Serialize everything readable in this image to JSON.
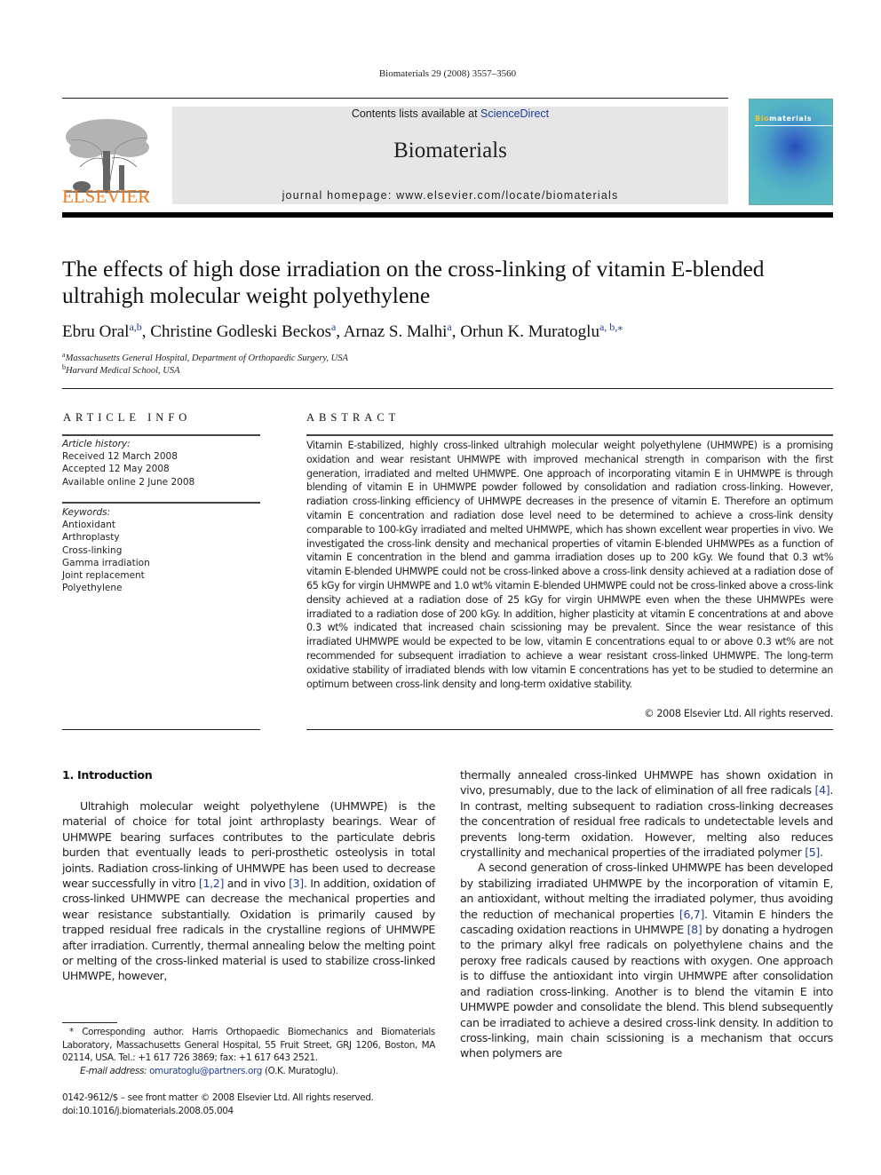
{
  "journal_ref": "Biomaterials 29 (2008) 3557–3560",
  "masthead": {
    "contents_prefix": "Contents lists available at ",
    "contents_link": "ScienceDirect",
    "journal_title": "Biomaterials",
    "homepage": "journal homepage: www.elsevier.com/locate/biomaterials"
  },
  "publisher": {
    "name": "ELSEVIER",
    "logo_icon": "elsevier-tree-icon",
    "brand_color": "#f07a1e"
  },
  "cover": {
    "title_part1": "Bio",
    "title_part2": "materials"
  },
  "article": {
    "title": "The effects of high dose irradiation on the cross-linking of vitamin E-blended ultrahigh molecular weight polyethylene",
    "authors": [
      {
        "name": "Ebru Oral",
        "aff": "a,b"
      },
      {
        "name": "Christine Godleski Beckos",
        "aff": "a"
      },
      {
        "name": "Arnaz S. Malhi",
        "aff": "a"
      },
      {
        "name": "Orhun K. Muratoglu",
        "aff": "a, b,⁎"
      }
    ],
    "affiliations": [
      {
        "mark": "a",
        "text": "Massachusetts General Hospital, Department of Orthopaedic Surgery, USA"
      },
      {
        "mark": "b",
        "text": "Harvard Medical School, USA"
      }
    ]
  },
  "article_info": {
    "heading": "ARTICLE INFO",
    "history_label": "Article history:",
    "history": [
      "Received 12 March 2008",
      "Accepted 12 May 2008",
      "Available online 2 June 2008"
    ],
    "keywords_label": "Keywords:",
    "keywords": [
      "Antioxidant",
      "Arthroplasty",
      "Cross-linking",
      "Gamma irradiation",
      "Joint replacement",
      "Polyethylene"
    ]
  },
  "abstract": {
    "heading": "ABSTRACT",
    "text": "Vitamin E-stabilized, highly cross-linked ultrahigh molecular weight polyethylene (UHMWPE) is a promising oxidation and wear resistant UHMWPE with improved mechanical strength in comparison with the first generation, irradiated and melted UHMWPE. One approach of incorporating vitamin E in UHMWPE is through blending of vitamin E in UHMWPE powder followed by consolidation and radiation cross-linking. However, radiation cross-linking efficiency of UHMWPE decreases in the presence of vitamin E. Therefore an optimum vitamin E concentration and radiation dose level need to be determined to achieve a cross-link density comparable to 100-kGy irradiated and melted UHMWPE, which has shown excellent wear properties in vivo. We investigated the cross-link density and mechanical properties of vitamin E-blended UHMWPEs as a function of vitamin E concentration in the blend and gamma irradiation doses up to 200 kGy. We found that 0.3 wt% vitamin E-blended UHMWPE could not be cross-linked above a cross-link density achieved at a radiation dose of 65 kGy for virgin UHMWPE and 1.0 wt% vitamin E-blended UHMWPE could not be cross-linked above a cross-link density achieved at a radiation dose of 25 kGy for virgin UHMWPE even when the these UHMWPEs were irradiated to a radiation dose of 200 kGy. In addition, higher plasticity at vitamin E concentrations at and above 0.3 wt% indicated that increased chain scissioning may be prevalent. Since the wear resistance of this irradiated UHMWPE would be expected to be low, vitamin E concentrations equal to or above 0.3 wt% are not recommended for subsequent irradiation to achieve a wear resistant cross-linked UHMWPE. The long-term oxidative stability of irradiated blends with low vitamin E concentrations has yet to be studied to determine an optimum between cross-link density and long-term oxidative stability.",
    "copyright": "© 2008 Elsevier Ltd. All rights reserved."
  },
  "introduction": {
    "heading": "1.  Introduction",
    "left_paragraph": [
      {
        "t": "Ultrahigh molecular weight polyethylene (UHMWPE) is the material of choice for total joint arthroplasty bearings. Wear of UHMWPE bearing surfaces contributes to the particulate debris burden that eventually leads to peri-prosthetic osteolysis in total joints. Radiation cross-linking of UHMWPE has been used to decrease wear successfully in vitro "
      },
      {
        "c": "[1,2]"
      },
      {
        "t": " and in vivo "
      },
      {
        "c": "[3]"
      },
      {
        "t": ". In addition, oxidation of cross-linked UHMWPE can decrease the mechanical properties and wear resistance substantially. Oxidation is primarily caused by trapped residual free radicals in the crystalline regions of UHMWPE after irradiation. Currently, thermal annealing below the melting point or melting of the cross-linked material is used to stabilize cross-linked UHMWPE, however,"
      }
    ],
    "right_paragraph_1": [
      {
        "t": "thermally annealed cross-linked UHMWPE has shown oxidation in vivo, presumably, due to the lack of elimination of all free radicals "
      },
      {
        "c": "[4]"
      },
      {
        "t": ". In contrast, melting subsequent to radiation cross-linking decreases the concentration of residual free radicals to undetectable levels and prevents long-term oxidation. However, melting also reduces crystallinity and mechanical properties of the irradiated polymer "
      },
      {
        "c": "[5]"
      },
      {
        "t": "."
      }
    ],
    "right_paragraph_2": [
      {
        "t": "A second generation of cross-linked UHMWPE has been developed by stabilizing irradiated UHMWPE by the incorporation of vitamin E, an antioxidant, without melting the irradiated polymer, thus avoiding the reduction of mechanical properties "
      },
      {
        "c": "[6,7]"
      },
      {
        "t": ". Vitamin E hinders the cascading oxidation reactions in UHMWPE "
      },
      {
        "c": "[8]"
      },
      {
        "t": " by donating a hydrogen to the primary alkyl free radicals on polyethylene chains and the peroxy free radicals caused by reactions with oxygen. One approach is to diffuse the antioxidant into virgin UHMWPE after consolidation and radiation cross-linking. Another is to blend the vitamin E into UHMWPE powder and consolidate the blend. This blend subsequently can be irradiated to achieve a desired cross-link density. In addition to cross-linking, main chain scissioning is a mechanism that occurs when polymers are"
      }
    ]
  },
  "footnote": {
    "corresponding": "* Corresponding author. Harris Orthopaedic Biomechanics and Biomaterials Laboratory, Massachusetts General Hospital, 55 Fruit Street, GRJ 1206, Boston, MA 02114, USA. Tel.: +1 617 726 3869; fax: +1 617 643 2521.",
    "email_label": "E-mail address:",
    "email": "omuratoglu@partners.org",
    "email_suffix": " (O.K. Muratoglu)."
  },
  "front_matter": {
    "issn_line": "0142-9612/$ – see front matter © 2008 Elsevier Ltd. All rights reserved.",
    "doi": "doi:10.1016/j.biomaterials.2008.05.004"
  },
  "colors": {
    "link": "#1f3f9a",
    "masthead_bg": "#e6e6e6"
  }
}
